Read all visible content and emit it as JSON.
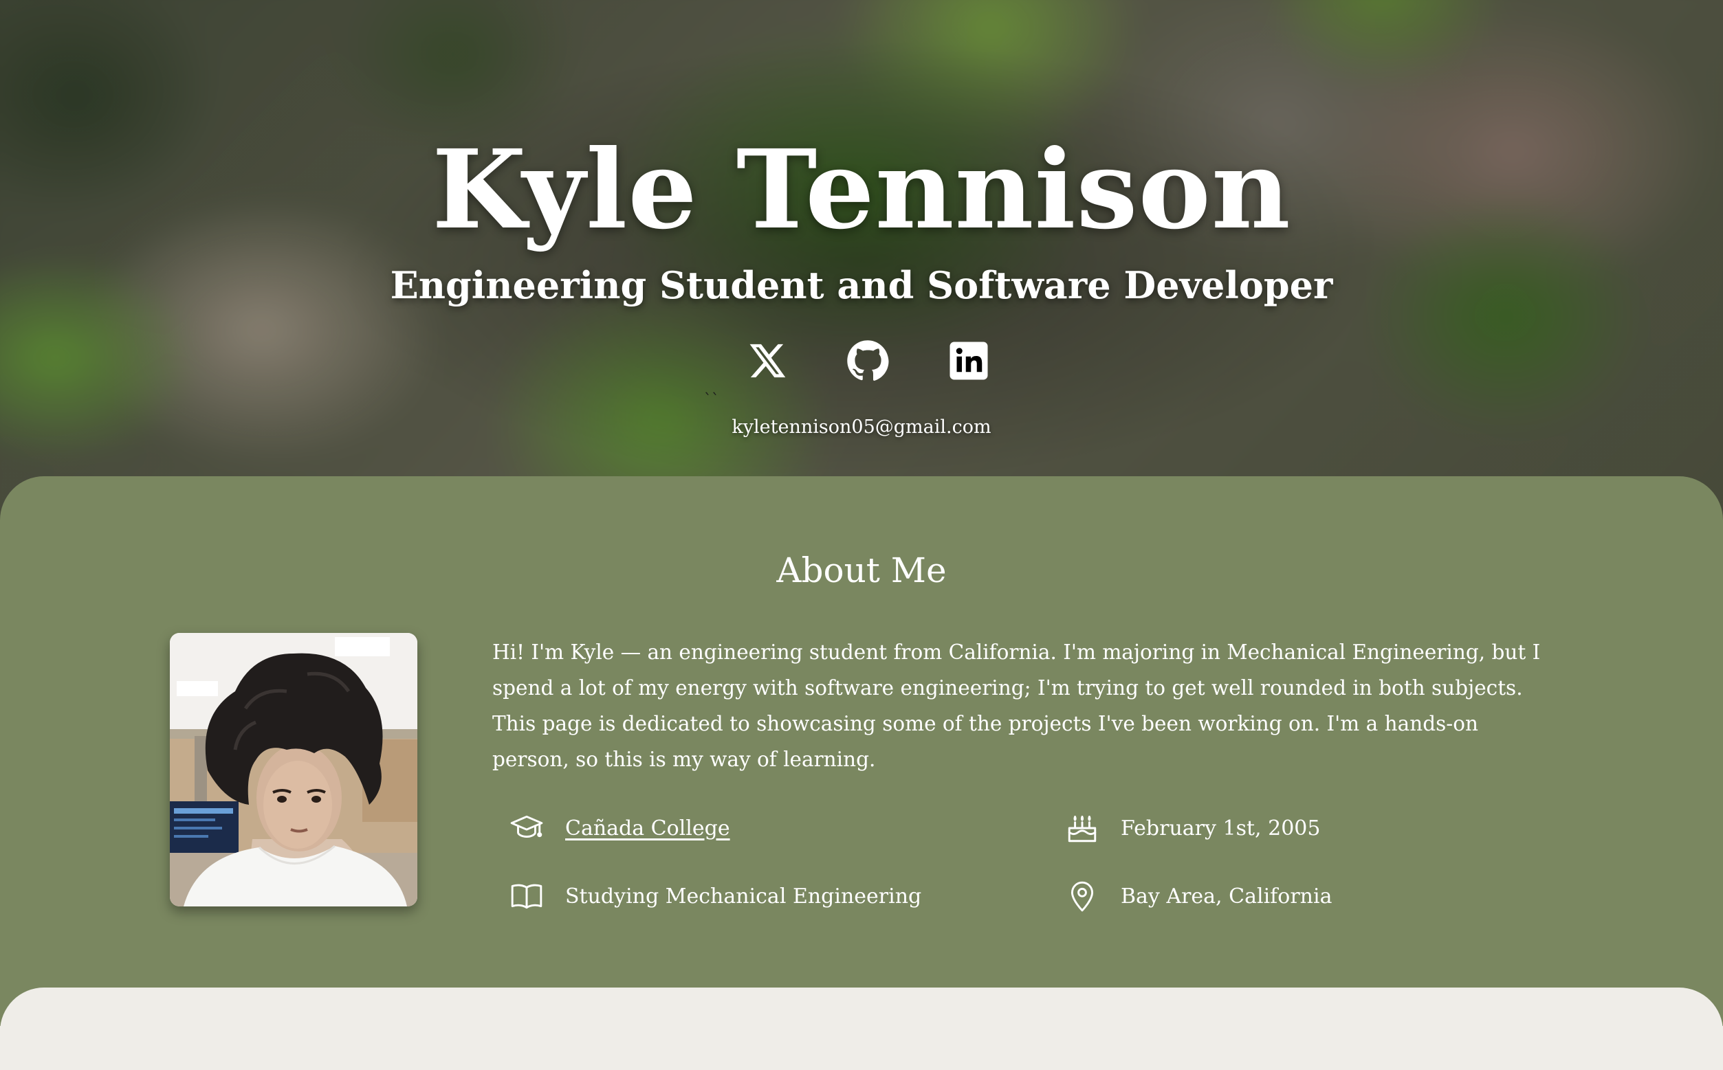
{
  "hero": {
    "name": "Kyle Tennison",
    "subtitle": "Engineering Student and Software Developer",
    "email": "kyletennison05@gmail.com",
    "stray_mark": "``",
    "socials": [
      {
        "icon": "x-twitter-icon"
      },
      {
        "icon": "github-icon"
      },
      {
        "icon": "linkedin-icon"
      }
    ]
  },
  "about": {
    "title": "About Me",
    "text": "Hi! I'm Kyle — an engineering student from California. I'm majoring in Mechanical Engineering, but I spend a lot of my energy with software engineering; I'm trying to get well rounded in both subjects. This page is dedicated to showcasing some of the projects I've been working on. I'm a hands-on person, so this is my way of learning.",
    "facts": {
      "school": {
        "icon": "graduation-cap-icon",
        "label": "Cañada College"
      },
      "major": {
        "icon": "book-icon",
        "label": "Studying Mechanical Engineering"
      },
      "birthday": {
        "icon": "cake-icon",
        "label": "February 1st, 2005"
      },
      "location": {
        "icon": "map-pin-icon",
        "label": "Bay Area, California"
      }
    }
  },
  "colors": {
    "about_bg": "#7a8760",
    "next_section_bg": "#efede8",
    "text": "#ffffff"
  }
}
